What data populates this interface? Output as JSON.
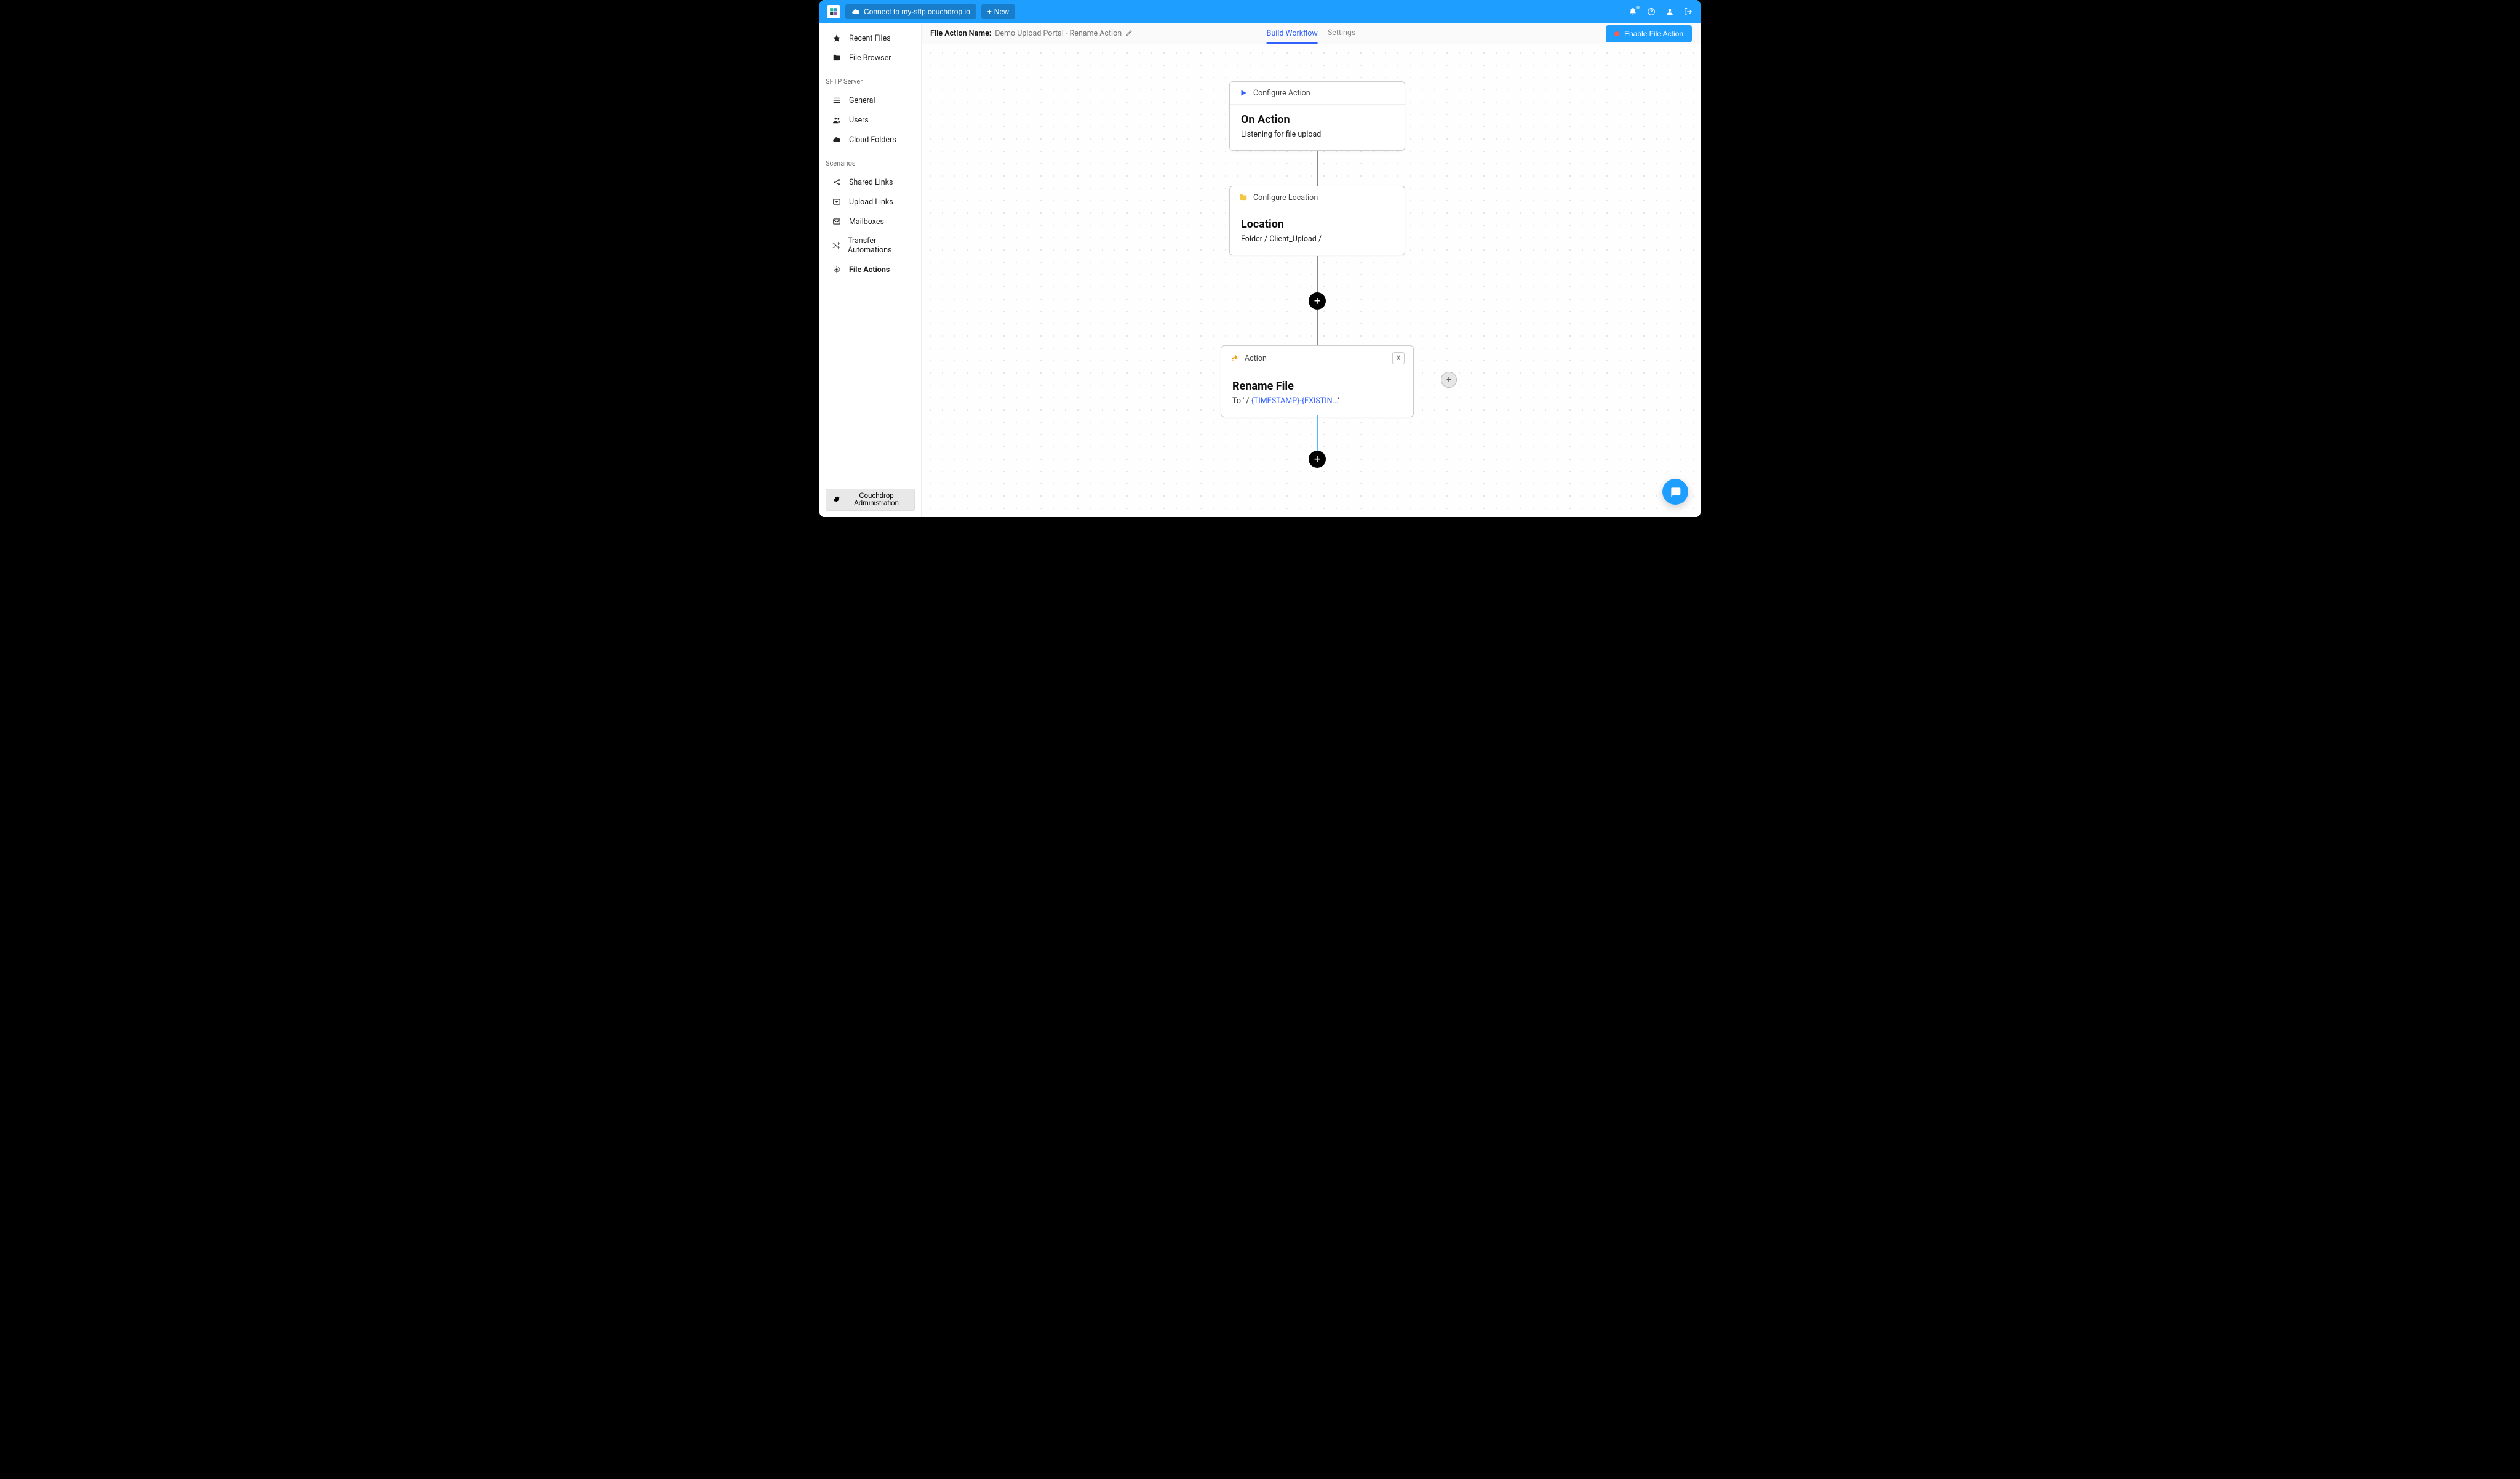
{
  "topbar": {
    "connect_label": "Connect to my-sftp.couchdrop.io",
    "new_label": "New"
  },
  "sidebar": {
    "items_top": [
      {
        "label": "Recent Files",
        "icon": "star"
      },
      {
        "label": "File Browser",
        "icon": "folder"
      }
    ],
    "heading_sftp": "SFTP Server",
    "items_sftp": [
      {
        "label": "General",
        "icon": "bars"
      },
      {
        "label": "Users",
        "icon": "users"
      },
      {
        "label": "Cloud Folders",
        "icon": "cloud"
      }
    ],
    "heading_scenarios": "Scenarios",
    "items_scenarios": [
      {
        "label": "Shared Links",
        "icon": "share"
      },
      {
        "label": "Upload Links",
        "icon": "upload"
      },
      {
        "label": "Mailboxes",
        "icon": "mail"
      },
      {
        "label": "Transfer Automations",
        "icon": "shuffle"
      },
      {
        "label": "File Actions",
        "icon": "gear",
        "active": true
      }
    ],
    "admin_label": "Couchdrop Administration"
  },
  "subheader": {
    "name_label": "File Action Name:",
    "name_value": "Demo Upload Portal - Rename Action",
    "tabs": [
      {
        "label": "Build Workflow",
        "active": true
      },
      {
        "label": "Settings",
        "active": false
      }
    ],
    "enable_label": "Enable File Action"
  },
  "nodes": {
    "configure_action": {
      "header": "Configure Action",
      "title": "On Action",
      "subtitle": "Listening for file upload"
    },
    "configure_location": {
      "header": "Configure Location",
      "title": "Location",
      "subtitle": "Folder / Client_Upload /"
    },
    "action": {
      "header": "Action",
      "title": "Rename File",
      "sub_prefix": "To ' / ",
      "sub_token": "{TIMESTAMP}-{EXISTIN...",
      "sub_suffix": "'",
      "close": "X"
    }
  }
}
